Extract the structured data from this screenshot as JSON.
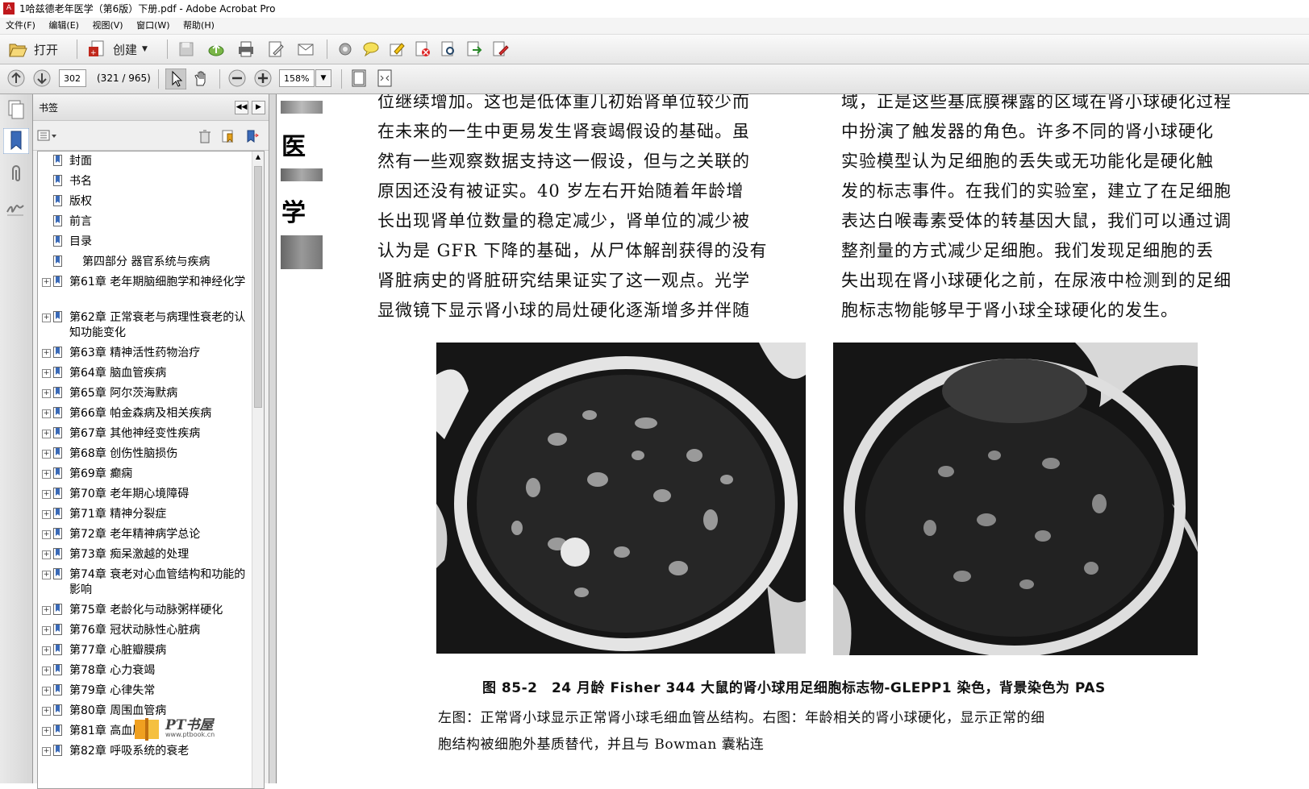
{
  "window": {
    "title": "1哈兹德老年医学（第6版）下册.pdf - Adobe Acrobat Pro",
    "icon": "acrobat-pdf-icon"
  },
  "menu": [
    "文件(F)",
    "编辑(E)",
    "视图(V)",
    "窗口(W)",
    "帮助(H)"
  ],
  "toolbar": {
    "open_label": "打开",
    "create_label": "创建"
  },
  "nav": {
    "page_value": "302",
    "page_info": "(321 / 965)",
    "zoom_value": "158%"
  },
  "bookmarks": {
    "title": "书签",
    "items": [
      {
        "label": "封面",
        "expandable": false,
        "indent": false
      },
      {
        "label": "书名",
        "expandable": false,
        "indent": false
      },
      {
        "label": "版权",
        "expandable": false,
        "indent": false
      },
      {
        "label": "前言",
        "expandable": false,
        "indent": false
      },
      {
        "label": "目录",
        "expandable": false,
        "indent": false
      },
      {
        "label": "第四部分 器官系统与疾病",
        "expandable": false,
        "indent": true
      },
      {
        "label": "第61章 老年期脑细胞学和神经化学",
        "expandable": true,
        "indent": false
      },
      {
        "label": "第62章 正常衰老与病理性衰老的认知功能变化",
        "expandable": true,
        "indent": false
      },
      {
        "label": "第63章 精神活性药物治疗",
        "expandable": true,
        "indent": false
      },
      {
        "label": "第64章 脑血管疾病",
        "expandable": true,
        "indent": false
      },
      {
        "label": "第65章 阿尔茨海默病",
        "expandable": true,
        "indent": false
      },
      {
        "label": "第66章 帕金森病及相关疾病",
        "expandable": true,
        "indent": false
      },
      {
        "label": "第67章 其他神经变性疾病",
        "expandable": true,
        "indent": false
      },
      {
        "label": "第68章 创伤性脑损伤",
        "expandable": true,
        "indent": false
      },
      {
        "label": "第69章 癫痫",
        "expandable": true,
        "indent": false
      },
      {
        "label": "第70章 老年期心境障碍",
        "expandable": true,
        "indent": false
      },
      {
        "label": "第71章 精神分裂症",
        "expandable": true,
        "indent": false
      },
      {
        "label": "第72章 老年精神病学总论",
        "expandable": true,
        "indent": false
      },
      {
        "label": "第73章 痴呆激越的处理",
        "expandable": true,
        "indent": false
      },
      {
        "label": "第74章 衰老对心血管结构和功能的影响",
        "expandable": true,
        "indent": false
      },
      {
        "label": "第75章 老龄化与动脉粥样硬化",
        "expandable": true,
        "indent": false
      },
      {
        "label": "第76章 冠状动脉性心脏病",
        "expandable": true,
        "indent": false
      },
      {
        "label": "第77章 心脏瓣膜病",
        "expandable": true,
        "indent": false
      },
      {
        "label": "第78章 心力衰竭",
        "expandable": true,
        "indent": false
      },
      {
        "label": "第79章 心律失常",
        "expandable": true,
        "indent": false
      },
      {
        "label": "第80章 周围血管病",
        "expandable": true,
        "indent": false
      },
      {
        "label": "第81章 高血压病",
        "expandable": true,
        "indent": false
      },
      {
        "label": "第82章 呼吸系统的衰老",
        "expandable": true,
        "indent": false
      }
    ]
  },
  "document": {
    "side_chars": [
      "医",
      "学"
    ],
    "left_column": [
      "位继续增加。这也是低体重儿初始肾单位较少而",
      "在未来的一生中更易发生肾衰竭假设的基础。虽",
      "然有一些观察数据支持这一假设，但与之关联的",
      "原因还没有被证实。40 岁左右开始随着年龄增",
      "长出现肾单位数量的稳定减少，肾单位的减少被",
      "认为是 GFR 下降的基础，从尸体解剖获得的没有",
      "肾脏病史的肾脏研究结果证实了这一观点。光学",
      "显微镜下显示肾小球的局灶硬化逐渐增多并伴随"
    ],
    "right_column": [
      "域，正是这些基底膜裸露的区域在肾小球硬化过程",
      "中扮演了触发器的角色。许多不同的肾小球硬化",
      "实验模型认为足细胞的丢失或无功能化是硬化触",
      "发的标志事件。在我们的实验室，建立了在足细胞",
      "表达白喉毒素受体的转基因大鼠，我们可以通过调",
      "整剂量的方式减少足细胞。我们发现足细胞的丢",
      "失出现在肾小球硬化之前，在尿液中检测到的足细",
      "胞标志物能够早于肾小球全球硬化的发生。"
    ],
    "figure_caption": "图 85-2　24 月龄 Fisher 344 大鼠的肾小球用足细胞标志物-GLEPP1 染色，背景染色为 PAS",
    "figure_desc": [
      "左图：正常肾小球显示正常肾小球毛细血管丛结构。右图：年龄相关的肾小球硬化，显示正常的细",
      "胞结构被细胞外基质替代，并且与 Bowman 囊粘连"
    ]
  },
  "watermark": {
    "brand": "PT书屋",
    "url": "www.ptbook.cn"
  }
}
